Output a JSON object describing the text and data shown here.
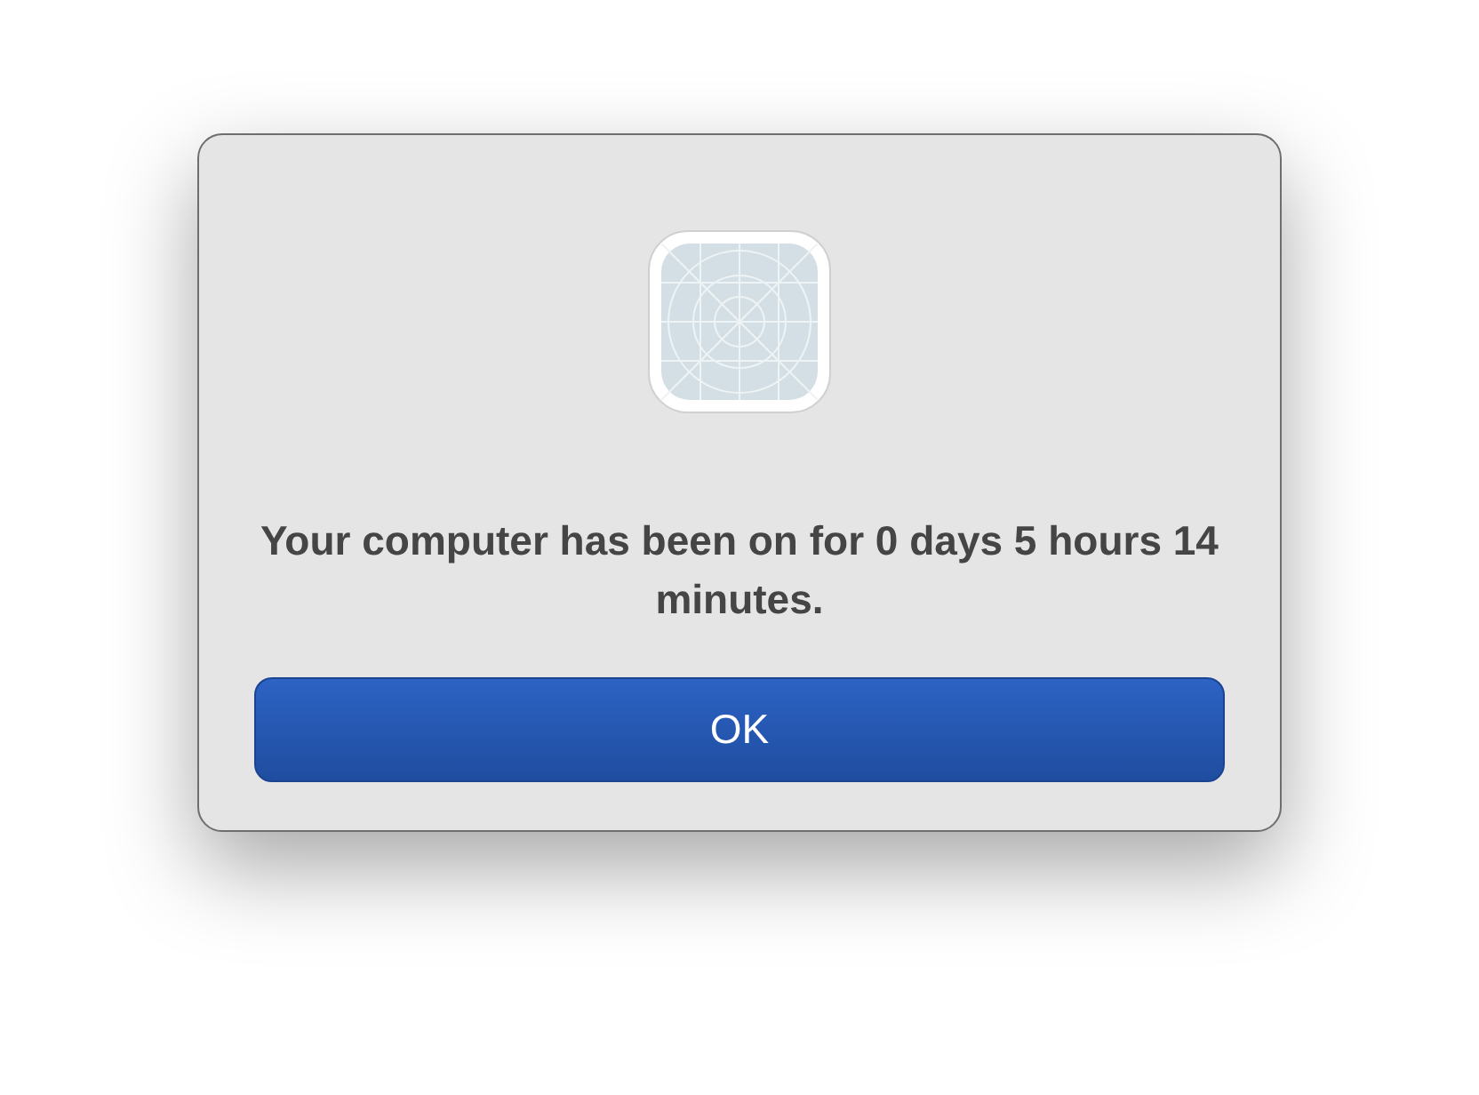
{
  "dialog": {
    "message": "Your computer has been on for 0 days 5 hours 14 minutes.",
    "buttons": [
      "OK"
    ]
  }
}
